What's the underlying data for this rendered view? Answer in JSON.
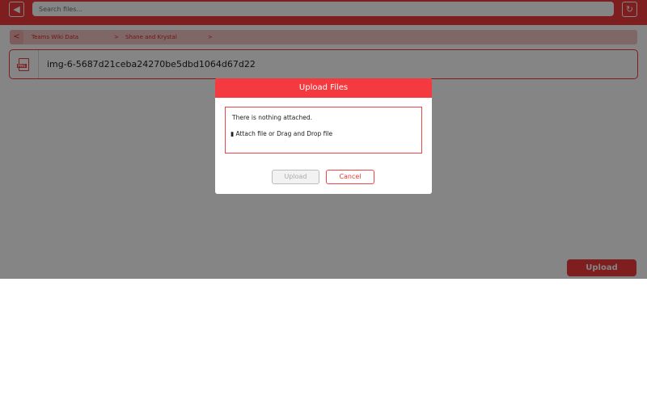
{
  "header": {
    "search_placeholder": "Search files...",
    "back_icon": "back-arrow-icon",
    "refresh_icon": "refresh-icon"
  },
  "breadcrumb": {
    "items": [
      "Teams Wiki Data",
      "Shane and Krystal"
    ],
    "separator": ">",
    "back": "<"
  },
  "file": {
    "type_badge": "PNG",
    "name": "img-6-5687d21ceba24270be5dbd1064d67d22"
  },
  "upload_button": "Upload",
  "dialog": {
    "title": "Upload Files",
    "empty_text": "There is nothing attached.",
    "attach_text": "Attach file or Drag and Drop file",
    "upload_label": "Upload",
    "cancel_label": "Cancel"
  },
  "colors": {
    "accent": "#f23b3b"
  }
}
